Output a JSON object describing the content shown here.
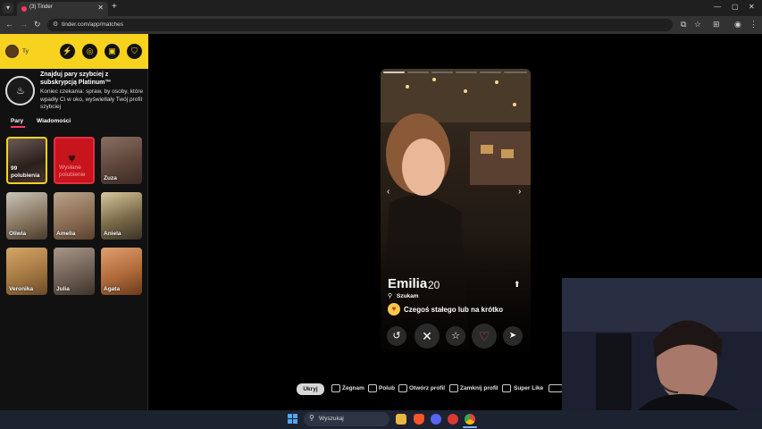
{
  "browser": {
    "tab_title": "(3) Tinder",
    "url": "tinder.com/app/matches",
    "tab_close": "✕",
    "new_tab": "+"
  },
  "sidebar": {
    "me_label": "Ty",
    "promo_title": "Znajduj pary szybciej z subskrypcją Platinum™",
    "promo_text": "Koniec czekania: spraw, by osoby, które wpadły Ci w oko, wyświetlały Twój profil szybciej",
    "tabs": [
      "Pary",
      "Wiadomości"
    ],
    "cards": [
      {
        "label": "99 polubienia"
      },
      {
        "label": "Wysłane polubienie"
      },
      {
        "label": "Zuza"
      },
      {
        "label": "Oliwia"
      },
      {
        "label": "Amelia"
      },
      {
        "label": "Aniela"
      },
      {
        "label": "Veronika"
      },
      {
        "label": "Julia"
      },
      {
        "label": "Agata"
      }
    ]
  },
  "profile": {
    "name": "Emilia",
    "age": "20",
    "status": "Szukam",
    "goal": "Czegoś stałego lub na krótko",
    "photo_count": 6,
    "active_photo": 1
  },
  "hints": {
    "button": "Ukryj",
    "items": [
      "Żegnam",
      "Polub",
      "Otwórz profil",
      "Zamknij profil",
      "Super Like"
    ]
  },
  "taskbar": {
    "search_placeholder": "Wyszukaj"
  },
  "colors": {
    "tinder_yellow": "#f7d21e",
    "tinder_pink": "#fd3a64",
    "like_red": "#e8445a"
  }
}
